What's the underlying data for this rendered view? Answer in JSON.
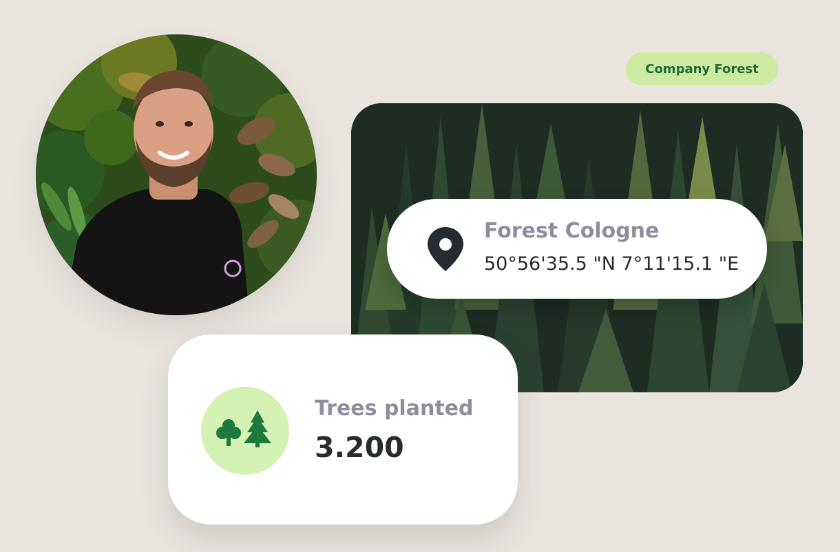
{
  "badge": {
    "label": "Company Forest"
  },
  "location": {
    "title": "Forest Cologne",
    "coordinates": "50°56'35.5 \"N 7°11'15.1 \"E",
    "icon": "map-pin-icon"
  },
  "stats": {
    "label": "Trees planted",
    "value": "3.200",
    "icon": "trees-icon"
  },
  "colors": {
    "background": "#e9e4de",
    "badge_bg": "#cdeaa3",
    "badge_text": "#1c6b34",
    "muted_text": "#8e8d9e",
    "dark_text": "#252b2e",
    "icon_circle": "#d4f2b4",
    "tree_green": "#1e7a3c"
  }
}
